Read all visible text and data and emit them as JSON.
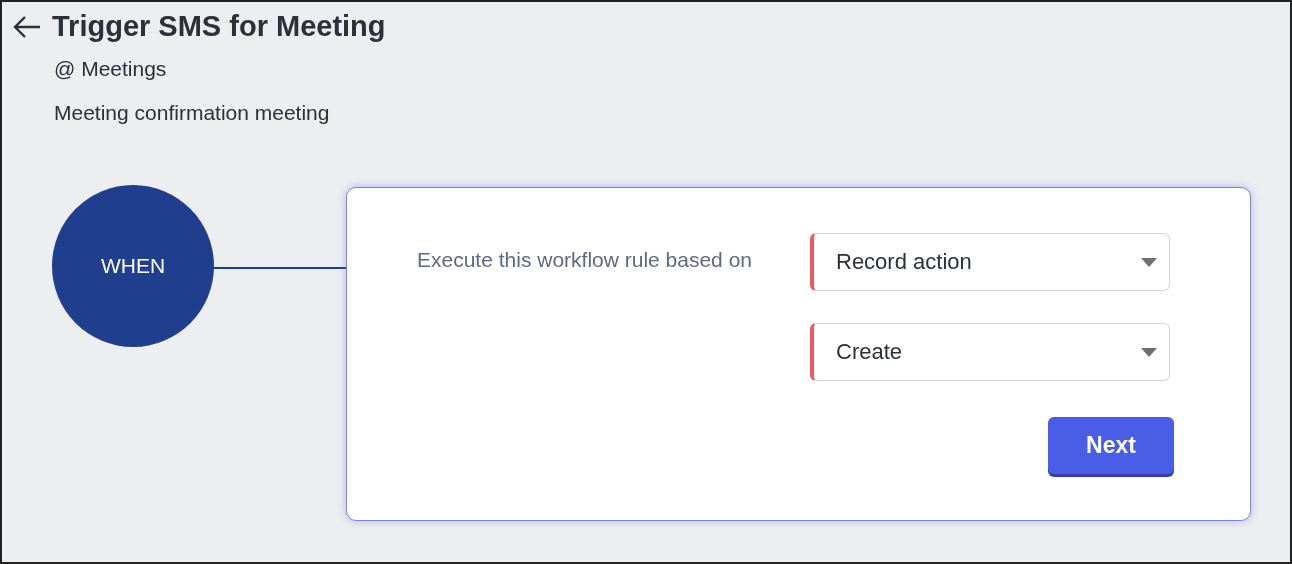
{
  "header": {
    "title": "Trigger SMS for Meeting",
    "module": "@ Meetings",
    "description": "Meeting confirmation meeting"
  },
  "trigger_node": {
    "label": "WHEN"
  },
  "card": {
    "label": "Execute this workflow rule based on",
    "selects": [
      {
        "value": "Record action",
        "required": true
      },
      {
        "value": "Create",
        "required": true
      }
    ],
    "button": "Next"
  }
}
